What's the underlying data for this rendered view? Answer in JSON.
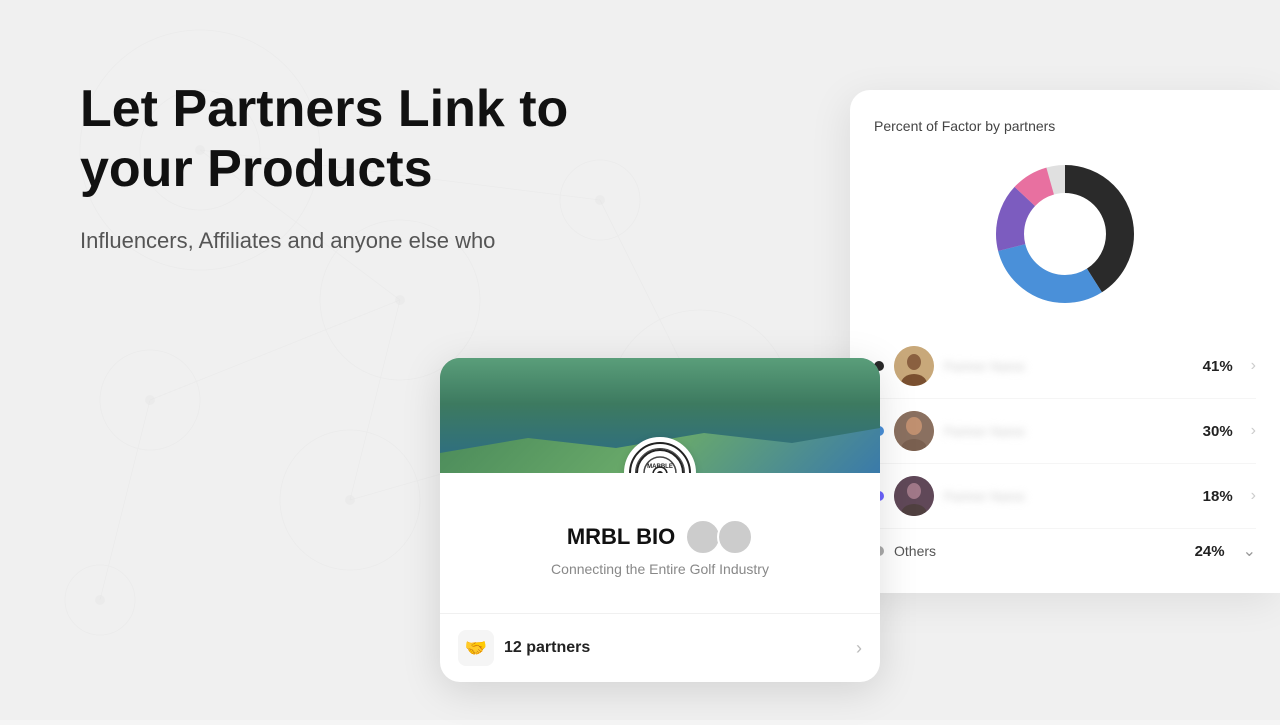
{
  "background": {
    "color": "#f0f0f0"
  },
  "hero": {
    "heading_line1": "Let Partners Link to",
    "heading_line2": "your Products",
    "subheading": "Influencers, Affiliates and anyone else who"
  },
  "golf_card": {
    "title": "MRBL BIO",
    "subtitle": "Connecting the Entire Golf Industry",
    "partners_label": "12 partners",
    "logo_text": "MARBLE\nGOLF"
  },
  "right_panel": {
    "title": "Percent of Factor by partners",
    "partners": [
      {
        "name": "Partner One",
        "pct": "41%",
        "dot_color": "#333",
        "avatar_class": "pa-1"
      },
      {
        "name": "Partner Two",
        "pct": "30%",
        "dot_color": "#4a90d9",
        "avatar_class": "pa-2"
      },
      {
        "name": "Partner Three",
        "pct": "18%",
        "dot_color": "#6c63ff",
        "avatar_class": "pa-3"
      }
    ],
    "others_label": "Others",
    "others_pct": "24%",
    "chart": {
      "segments": [
        {
          "label": "Partner One",
          "value": 41,
          "color": "#333333"
        },
        {
          "label": "Partner Two",
          "value": 30,
          "color": "#4a90d9"
        },
        {
          "label": "Partner Three",
          "value": 18,
          "color": "#7c5cbf"
        },
        {
          "label": "Others",
          "value": 11,
          "color": "#e870a0"
        }
      ]
    }
  }
}
